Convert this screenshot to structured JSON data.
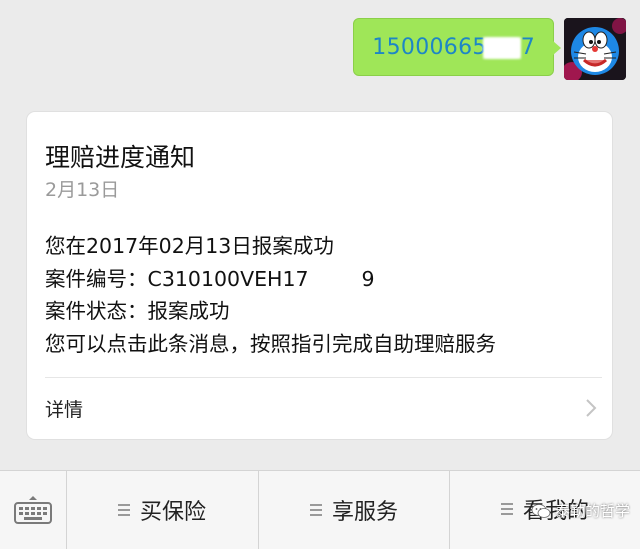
{
  "chat": {
    "outgoing_message": "15000665",
    "outgoing_message_tail": "7",
    "avatar_desc": "doraemon"
  },
  "card": {
    "title": "理赔进度通知",
    "date": "2月13日",
    "lines": [
      "您在2017年02月13日报案成功",
      "案件编号：C310100VEH17",
      "案件状态：报案成功",
      "您可以点击此条消息，按照指引完成自助理赔服务"
    ],
    "line2_tail": "9",
    "detail_label": "详情"
  },
  "menu": {
    "items": [
      "买保险",
      "享服务",
      "看我的"
    ]
  },
  "watermark": {
    "text": "泰勒的哲学"
  },
  "colors": {
    "bubble": "#9fe658",
    "bubble_text": "#1d86c6",
    "background": "#ebebeb"
  }
}
